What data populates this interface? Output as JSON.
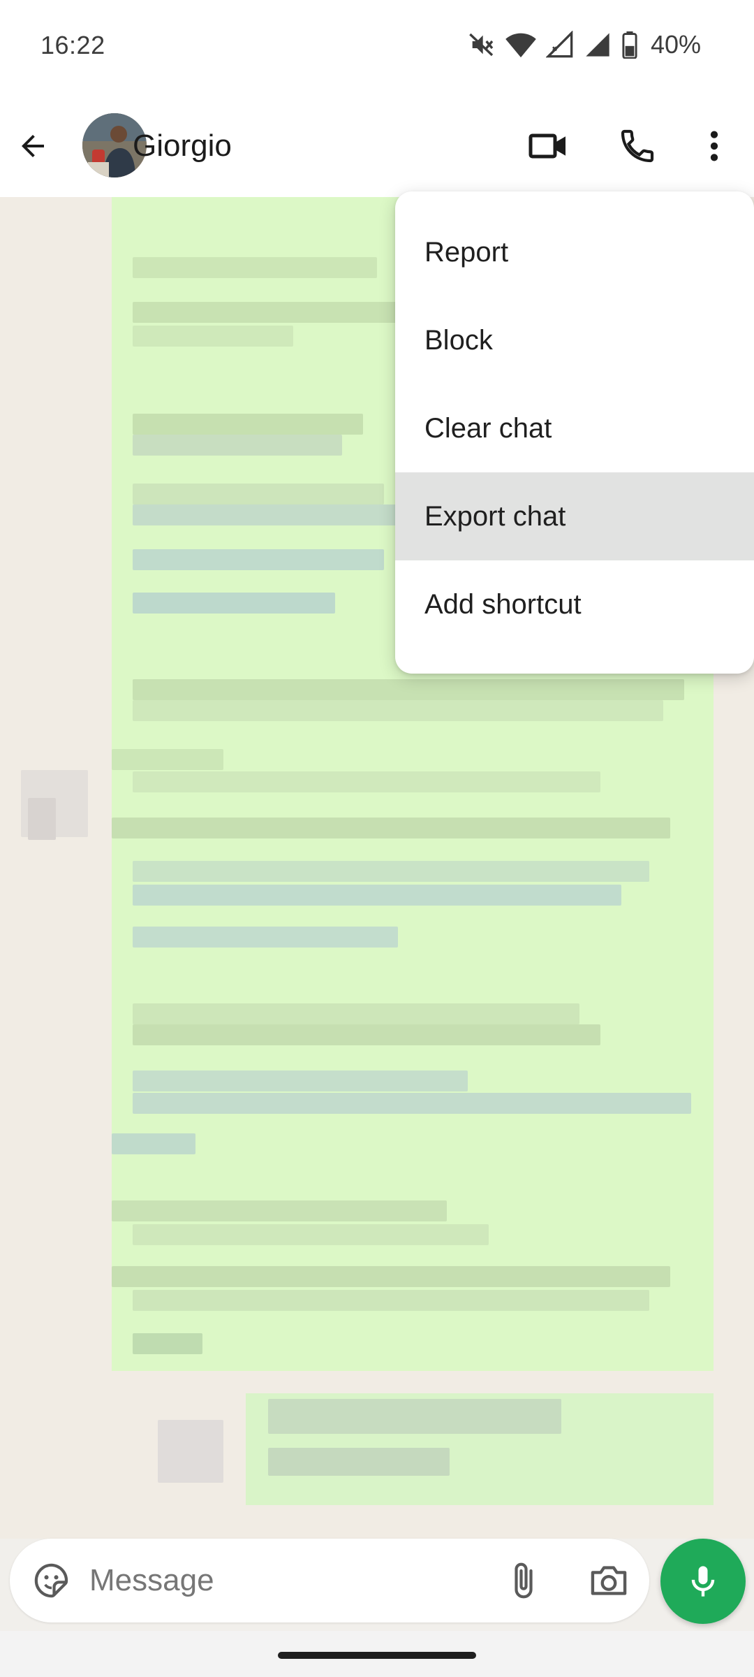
{
  "status_bar": {
    "time": "16:22",
    "battery": "40%",
    "icons": [
      "mute-icon",
      "wifi-icon",
      "signal-x-icon",
      "signal-icon",
      "battery-icon"
    ]
  },
  "header": {
    "contact_name": "Giorgio",
    "back_icon": "arrow-back-icon",
    "video_icon": "video-call-icon",
    "call_icon": "voice-call-icon",
    "more_icon": "more-vertical-icon"
  },
  "menu": {
    "items": [
      {
        "label": "Report"
      },
      {
        "label": "Block"
      },
      {
        "label": "Clear chat"
      },
      {
        "label": "Export chat",
        "highlighted": true
      },
      {
        "label": "Add shortcut"
      }
    ]
  },
  "composer": {
    "placeholder": "Message",
    "value": "",
    "emoji_icon": "sticker-icon",
    "attach_icon": "paperclip-icon",
    "camera_icon": "camera-icon",
    "mic_icon": "microphone-icon"
  },
  "colors": {
    "accent": "#1faa59",
    "bubble_out": "#dcf8c6",
    "chat_background": "#f1ece4",
    "menu_highlight": "#e1e2e1"
  }
}
